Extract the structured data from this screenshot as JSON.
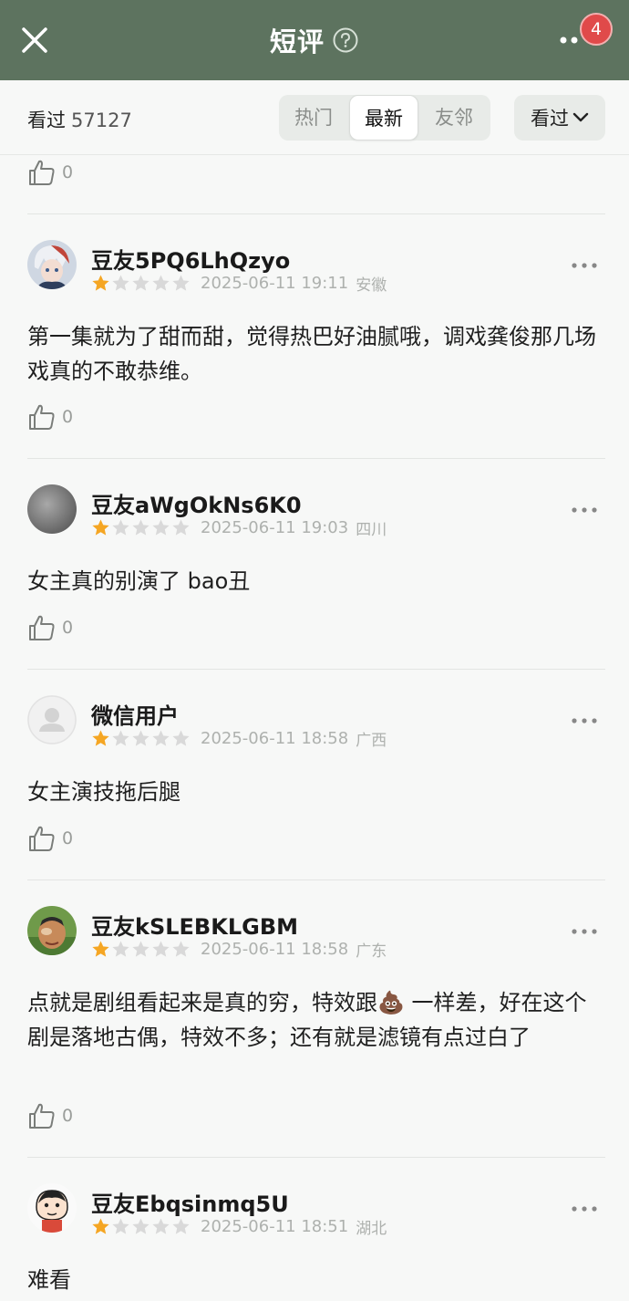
{
  "header": {
    "title": "短评",
    "badge_count": "4",
    "color": "#5d735f"
  },
  "filter": {
    "seen_label": "看过",
    "seen_count": "57127",
    "tabs": [
      {
        "label": "热门",
        "active": false
      },
      {
        "label": "最新",
        "active": true
      },
      {
        "label": "友邻",
        "active": false
      }
    ],
    "dropdown_label": "看过"
  },
  "top_partial": {
    "like_count": "0"
  },
  "reviews": [
    {
      "user": "豆友5PQ6LhQzyo",
      "rating": 1,
      "time": "2025-06-11 19:11",
      "location": "安徽",
      "content": "第一集就为了甜而甜，觉得热巴好油腻哦，调戏龚俊那几场戏真的不敢恭维。",
      "likes": "0",
      "avatar": "anime-avatar"
    },
    {
      "user": "豆友aWgOkNs6K0",
      "rating": 1,
      "time": "2025-06-11 19:03",
      "location": "四川",
      "content": "女主真的别演了 bao丑",
      "likes": "0",
      "avatar": "grey-avatar"
    },
    {
      "user": "微信用户",
      "rating": 1,
      "time": "2025-06-11 18:58",
      "location": "广西",
      "content": "女主演技拖后腿",
      "likes": "0",
      "avatar": "default-avatar"
    },
    {
      "user": "豆友kSLEBKLGBM",
      "rating": 1,
      "time": "2025-06-11 18:58",
      "location": "广东",
      "content_parts": [
        "点就是剧组看起来是真的穷，特效跟",
        "💩",
        " 一样差，好在这个剧是落地古偶，特效不多；还有就是滤镜有点过白了"
      ],
      "likes": "0",
      "avatar": "photo-avatar"
    },
    {
      "user": "豆友Ebqsinmq5U",
      "rating": 1,
      "time": "2025-06-11 18:51",
      "location": "湖北",
      "content": "难看",
      "avatar": "cartoon-avatar"
    }
  ],
  "colors": {
    "star_filled": "#f5a623",
    "star_empty": "#d9d9d9",
    "accent": "#5d735f"
  }
}
